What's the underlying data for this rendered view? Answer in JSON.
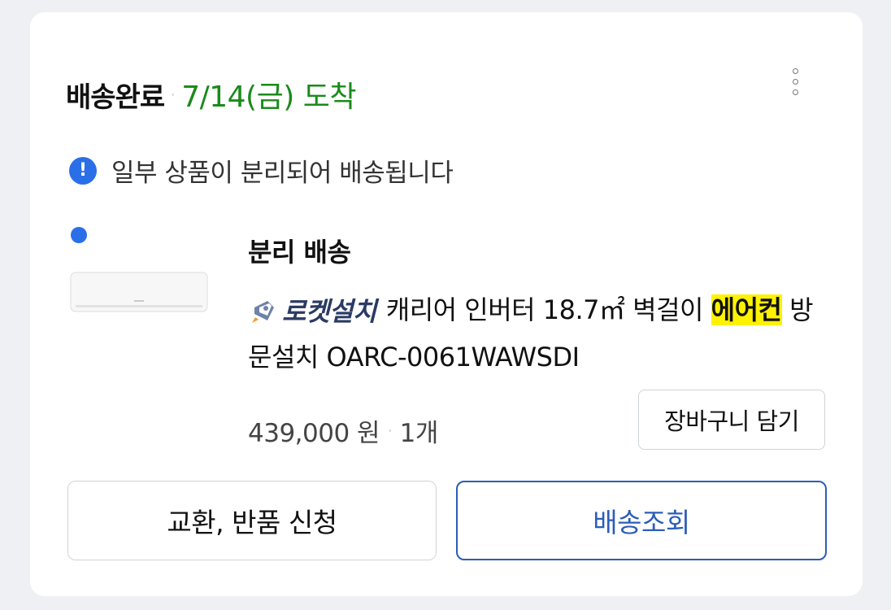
{
  "header": {
    "status": "배송완료",
    "separator": "·",
    "arrival": "7/14(금) 도착"
  },
  "more_icon": "more-vertical-icon",
  "notice": {
    "icon": "exclamation-icon",
    "text": "일부 상품이 분리되어 배송됩니다"
  },
  "shipment": {
    "title": "분리 배송",
    "product": {
      "badge_label": "로켓설치",
      "badge_icon": "rocket-icon",
      "name_prefix": "캐리어 인버터 18.7㎡ 벽걸이 ",
      "highlight": "에어컨",
      "name_suffix": " 방문설치 OARC-0061WAWSDI",
      "price": "439,000 원",
      "quantity": "1개"
    },
    "cart_button": "장바구니 담기"
  },
  "actions": {
    "return_button": "교환, 반품 신청",
    "track_button": "배송조회"
  },
  "colors": {
    "arrival": "#1b8a1b",
    "accent_blue": "#2a6fe8",
    "track_border": "#2c5db7",
    "highlight": "#fff200"
  }
}
